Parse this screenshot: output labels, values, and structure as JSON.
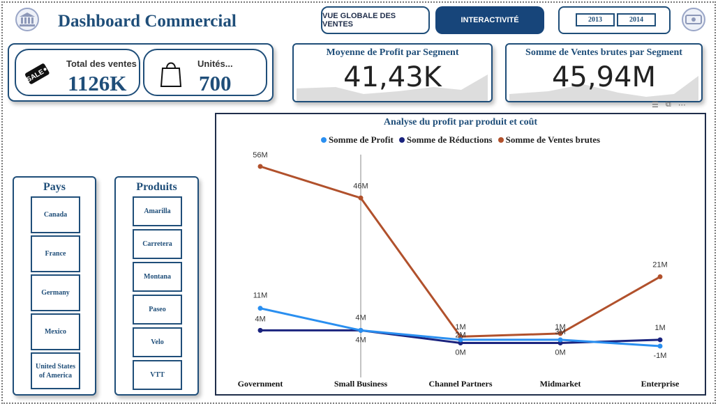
{
  "header": {
    "title": "Dashboard Commercial",
    "nav_sales_overview": "VUE GLOBALE DES VENTES",
    "nav_interactivity": "INTERACTIVITÉ",
    "years": [
      "2013",
      "2014"
    ],
    "left_logo_icon": "bank-icon",
    "right_logo_icon": "money-icon"
  },
  "kpis": {
    "total_sales_label": "Total des ventes",
    "total_sales_value": "1126K",
    "units_label": "Unités...",
    "units_value": "700",
    "sale_icon": "sale-tag-icon",
    "bag_icon": "shopping-bag-icon"
  },
  "segment_cards": {
    "profit_title": "Moyenne de Profit par Segment",
    "profit_value": "41,43K",
    "sales_title": "Somme de Ventes brutes par Segment",
    "sales_value": "45,94M"
  },
  "slicers": {
    "pays": {
      "title": "Pays",
      "items": [
        "Canada",
        "France",
        "Germany",
        "Mexico",
        "United States of America"
      ]
    },
    "produits": {
      "title": "Produits",
      "items": [
        "Amarilla",
        "Carretera",
        "Montana",
        "Paseo",
        "Velo",
        "VTT"
      ]
    }
  },
  "colors": {
    "primary": "#1f4e79",
    "nav_active": "#17457a",
    "profit": "#2a8ff0",
    "reductions": "#1a237e",
    "gross_sales": "#b1512c"
  },
  "chart_data": {
    "type": "line",
    "title": "Analyse du profit par produit et coût",
    "categories": [
      "Government",
      "Small Business",
      "Channel Partners",
      "Midmarket",
      "Enterprise"
    ],
    "series": [
      {
        "name": "Somme de Profit",
        "values": [
          11,
          4,
          1,
          1,
          -1
        ],
        "labels": [
          "11M",
          "4M",
          "1M",
          "1M",
          "-1M"
        ],
        "color": "#2a8ff0"
      },
      {
        "name": "Somme de Réductions",
        "values": [
          4,
          4,
          0,
          0,
          1
        ],
        "labels": [
          "4M",
          "4M",
          "0M",
          "0M",
          "1M"
        ],
        "color": "#1a237e"
      },
      {
        "name": "Somme de Ventes brutes",
        "values": [
          56,
          46,
          2,
          3,
          21
        ],
        "labels": [
          "56M",
          "46M",
          "2M",
          "3M",
          "21M"
        ],
        "color": "#b1512c"
      }
    ],
    "ylim": [
      -1,
      56
    ],
    "grid": false,
    "legend_position": "top",
    "highlight_category": "Small Business"
  }
}
